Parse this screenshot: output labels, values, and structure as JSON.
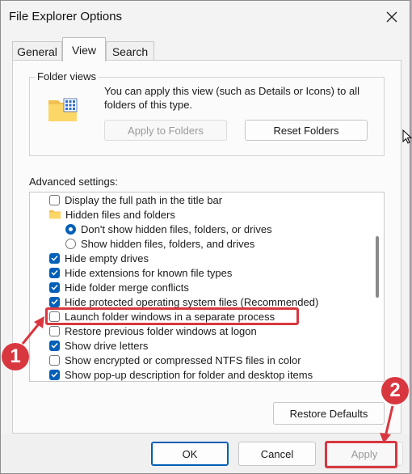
{
  "window": {
    "title": "File Explorer Options"
  },
  "tabs": [
    {
      "label": "General"
    },
    {
      "label": "View",
      "active": true
    },
    {
      "label": "Search"
    }
  ],
  "folder_views": {
    "label": "Folder views",
    "description": "You can apply this view (such as Details or Icons) to all folders of this type.",
    "apply_button": "Apply to Folders",
    "reset_button": "Reset Folders"
  },
  "advanced": {
    "label": "Advanced settings:",
    "items": [
      {
        "type": "checkbox",
        "label": "Display the full path in the title bar",
        "checked": false
      },
      {
        "type": "folder",
        "label": "Hidden files and folders"
      },
      {
        "type": "radio",
        "label": "Don't show hidden files, folders, or drives",
        "checked": true
      },
      {
        "type": "radio",
        "label": "Show hidden files, folders, and drives",
        "checked": false
      },
      {
        "type": "checkbox",
        "label": "Hide empty drives",
        "checked": true
      },
      {
        "type": "checkbox",
        "label": "Hide extensions for known file types",
        "checked": true
      },
      {
        "type": "checkbox",
        "label": "Hide folder merge conflicts",
        "checked": true
      },
      {
        "type": "checkbox",
        "label": "Hide protected operating system files (Recommended)",
        "checked": true
      },
      {
        "type": "checkbox",
        "label": "Launch folder windows in a separate process",
        "checked": false
      },
      {
        "type": "checkbox",
        "label": "Restore previous folder windows at logon",
        "checked": false
      },
      {
        "type": "checkbox",
        "label": "Show drive letters",
        "checked": true
      },
      {
        "type": "checkbox",
        "label": "Show encrypted or compressed NTFS files in color",
        "checked": false
      },
      {
        "type": "checkbox",
        "label": "Show pop-up description for folder and desktop items",
        "checked": true
      }
    ],
    "restore_defaults": "Restore Defaults"
  },
  "dialog_buttons": {
    "ok": "OK",
    "cancel": "Cancel",
    "apply": "Apply"
  },
  "annotations": {
    "marker1": "1",
    "marker2": "2"
  },
  "colors": {
    "accent": "#005fb8",
    "annotation": "#d9373f"
  }
}
